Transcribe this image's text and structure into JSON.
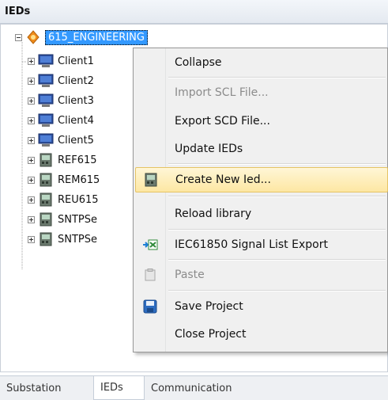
{
  "panel": {
    "title": "IEDs"
  },
  "tree": {
    "root": {
      "label": "615_ENGINEERING",
      "icon": "project-icon"
    },
    "children": [
      {
        "label": "Client1",
        "icon": "computer-icon"
      },
      {
        "label": "Client2",
        "icon": "computer-icon"
      },
      {
        "label": "Client3",
        "icon": "computer-icon"
      },
      {
        "label": "Client4",
        "icon": "computer-icon"
      },
      {
        "label": "Client5",
        "icon": "computer-icon"
      },
      {
        "label": "REF615",
        "icon": "ied-device-icon"
      },
      {
        "label": "REM615",
        "icon": "ied-device-icon"
      },
      {
        "label": "REU615",
        "icon": "ied-device-icon"
      },
      {
        "label": "SNTPSe",
        "icon": "ied-device-icon"
      },
      {
        "label": "SNTPSe",
        "icon": "ied-device-icon"
      }
    ]
  },
  "context_menu": {
    "items": [
      {
        "label": "Collapse",
        "enabled": true,
        "icon": ""
      },
      {
        "label": "Import SCL File...",
        "enabled": false,
        "icon": ""
      },
      {
        "label": "Export SCD File...",
        "enabled": true,
        "icon": ""
      },
      {
        "label": "Update IEDs",
        "enabled": true,
        "icon": ""
      },
      {
        "label": "Create New Ied...",
        "enabled": true,
        "icon": "ied-device-icon",
        "highlighted": true
      },
      {
        "label": "Reload library",
        "enabled": true,
        "icon": ""
      },
      {
        "label": "IEC61850 Signal List Export",
        "enabled": true,
        "icon": "signal-export-icon"
      },
      {
        "label": "Paste",
        "enabled": false,
        "icon": "paste-icon"
      },
      {
        "label": "Save Project",
        "enabled": true,
        "icon": "save-disk-icon"
      },
      {
        "label": "Close Project",
        "enabled": true,
        "icon": ""
      }
    ]
  },
  "tabs": [
    {
      "label": "Substation",
      "active": false
    },
    {
      "label": "IEDs",
      "active": true
    },
    {
      "label": "Communication",
      "active": false
    }
  ],
  "colors": {
    "selection": "#3399ff",
    "menu_highlight": "#fde7a3",
    "header_bg": "#e4e9f0"
  }
}
